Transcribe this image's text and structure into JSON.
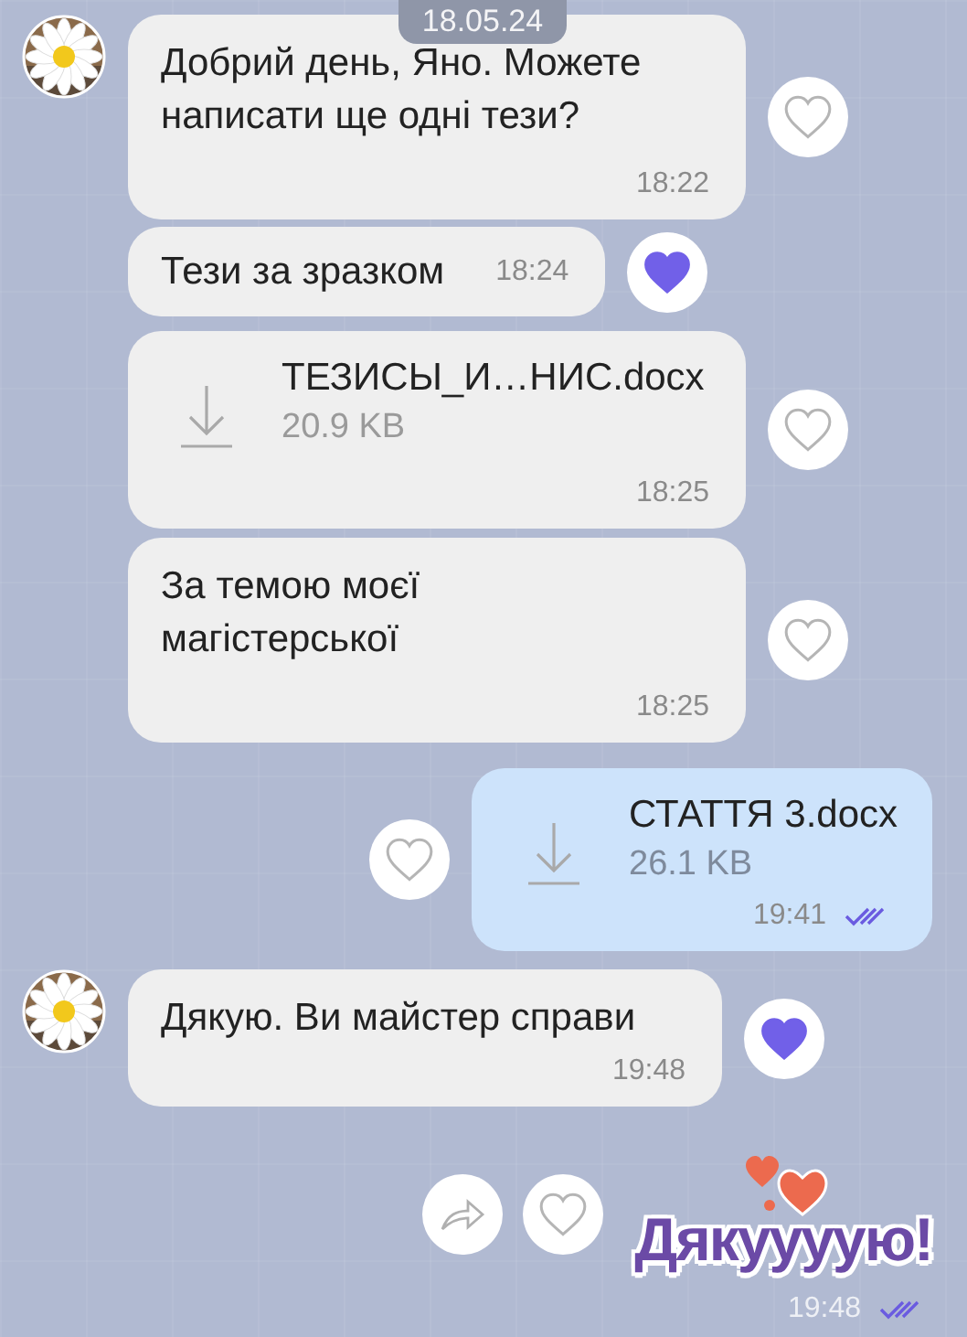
{
  "date_badge": "18.05.24",
  "messages": [
    {
      "kind": "text",
      "outgoing": false,
      "avatar": true,
      "text": "Добрий день, Яно. Можете\nнаписати ще одні тези?",
      "time": "18:22",
      "liked": false
    },
    {
      "kind": "text",
      "outgoing": false,
      "text": "Тези за зразком",
      "time": "18:24",
      "liked": true
    },
    {
      "kind": "file",
      "outgoing": false,
      "file_name": "ТЕЗИСЫ_И…НИС.docx",
      "file_size": "20.9 KB",
      "time": "18:25",
      "liked": false
    },
    {
      "kind": "text",
      "outgoing": false,
      "text": "За темою моєї\nмагістерської",
      "time": "18:25",
      "liked": false
    },
    {
      "kind": "file",
      "outgoing": true,
      "file_name": "СТАТТЯ 3.docx",
      "file_size": "26.1 KB",
      "time": "19:41",
      "liked": false,
      "read": true
    },
    {
      "kind": "text",
      "outgoing": false,
      "avatar": true,
      "text": "Дякую. Ви майстер справи",
      "time": "19:48",
      "liked": true
    },
    {
      "kind": "sticker",
      "outgoing": true,
      "text": "Дякуууую!",
      "time": "19:48",
      "liked": false,
      "read": true,
      "shareable": true
    }
  ]
}
